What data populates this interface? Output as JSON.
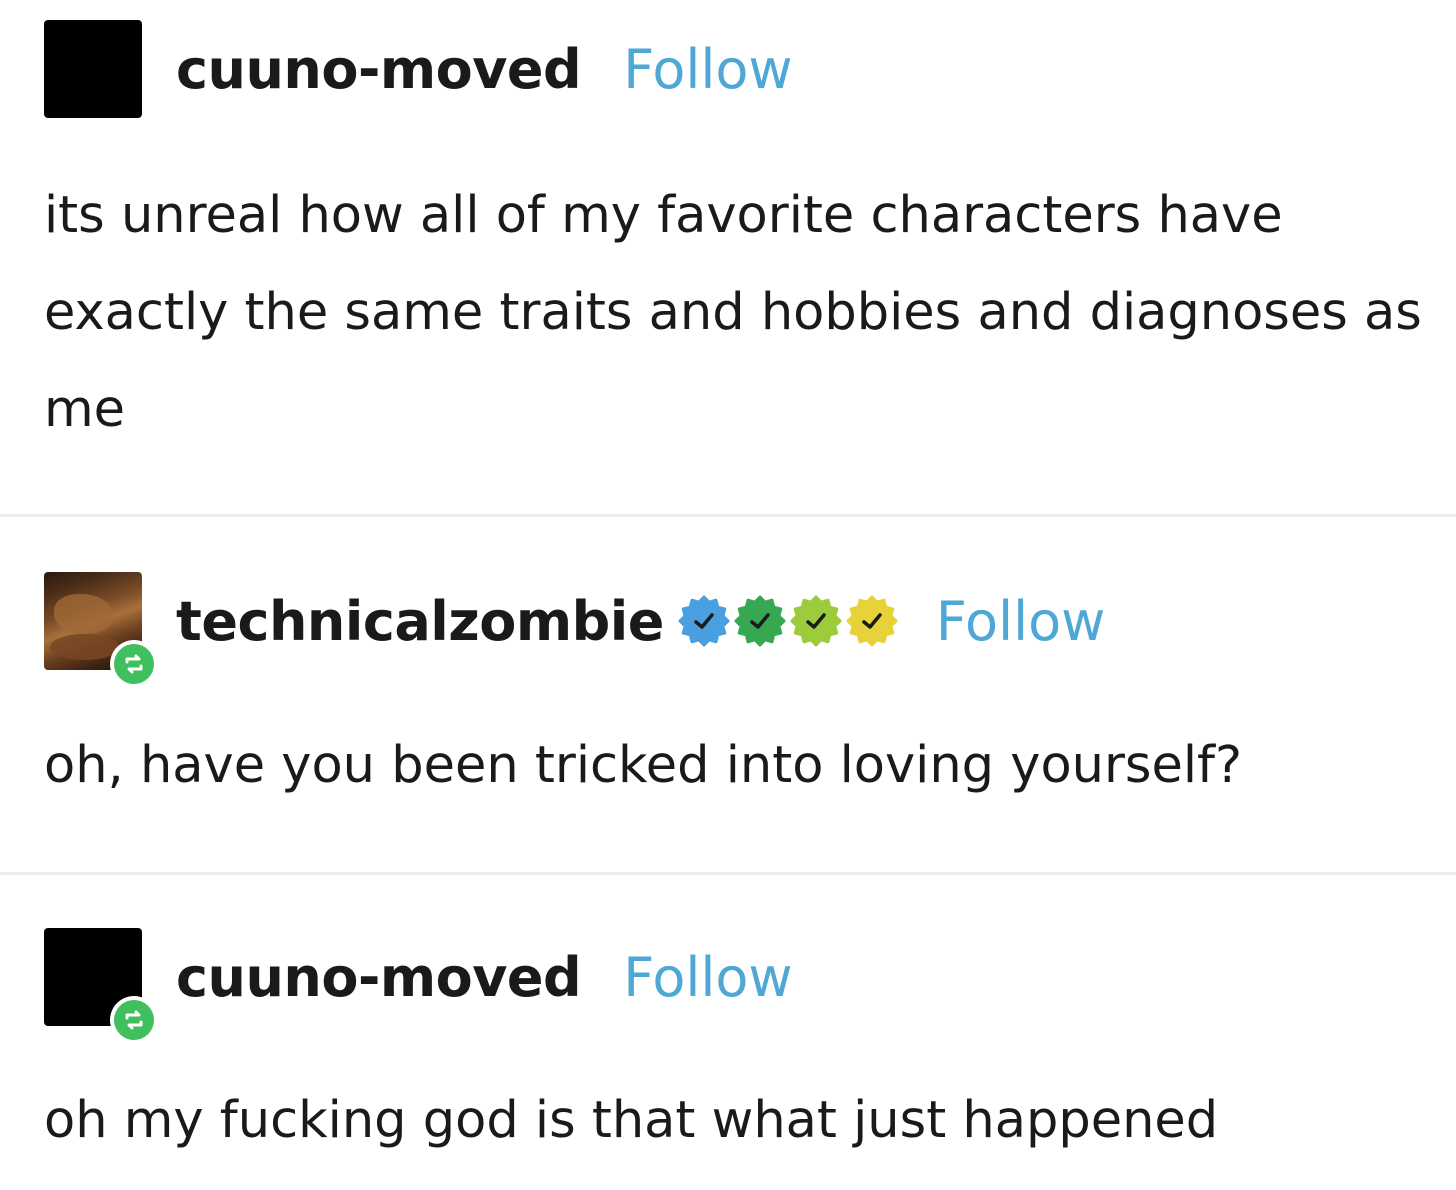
{
  "posts": [
    {
      "username": "cuuno-moved",
      "follow_label": "Follow",
      "body": "its unreal how all of my favorite characters have exactly the same traits and hobbies and diagnoses as me",
      "avatar": "black-square",
      "reblogged": false
    },
    {
      "username": "technicalzombie",
      "follow_label": "Follow",
      "body": "oh, have you been tricked into loving yourself?",
      "avatar": "photo",
      "reblogged": true,
      "badges": [
        {
          "icon": "verified-check-icon",
          "color": "#4a9fe0"
        },
        {
          "icon": "verified-check-icon",
          "color": "#36a852"
        },
        {
          "icon": "verified-check-icon",
          "color": "#9ccc3c"
        },
        {
          "icon": "verified-check-icon",
          "color": "#e8d23a"
        }
      ]
    },
    {
      "username": "cuuno-moved",
      "follow_label": "Follow",
      "body": "oh my fucking god is that what just happened",
      "avatar": "black-square",
      "reblogged": true
    }
  ],
  "colors": {
    "follow": "#4fa7d6",
    "reblog": "#3fbf5e",
    "text": "#1a1a1a",
    "divider": "#ececec"
  }
}
